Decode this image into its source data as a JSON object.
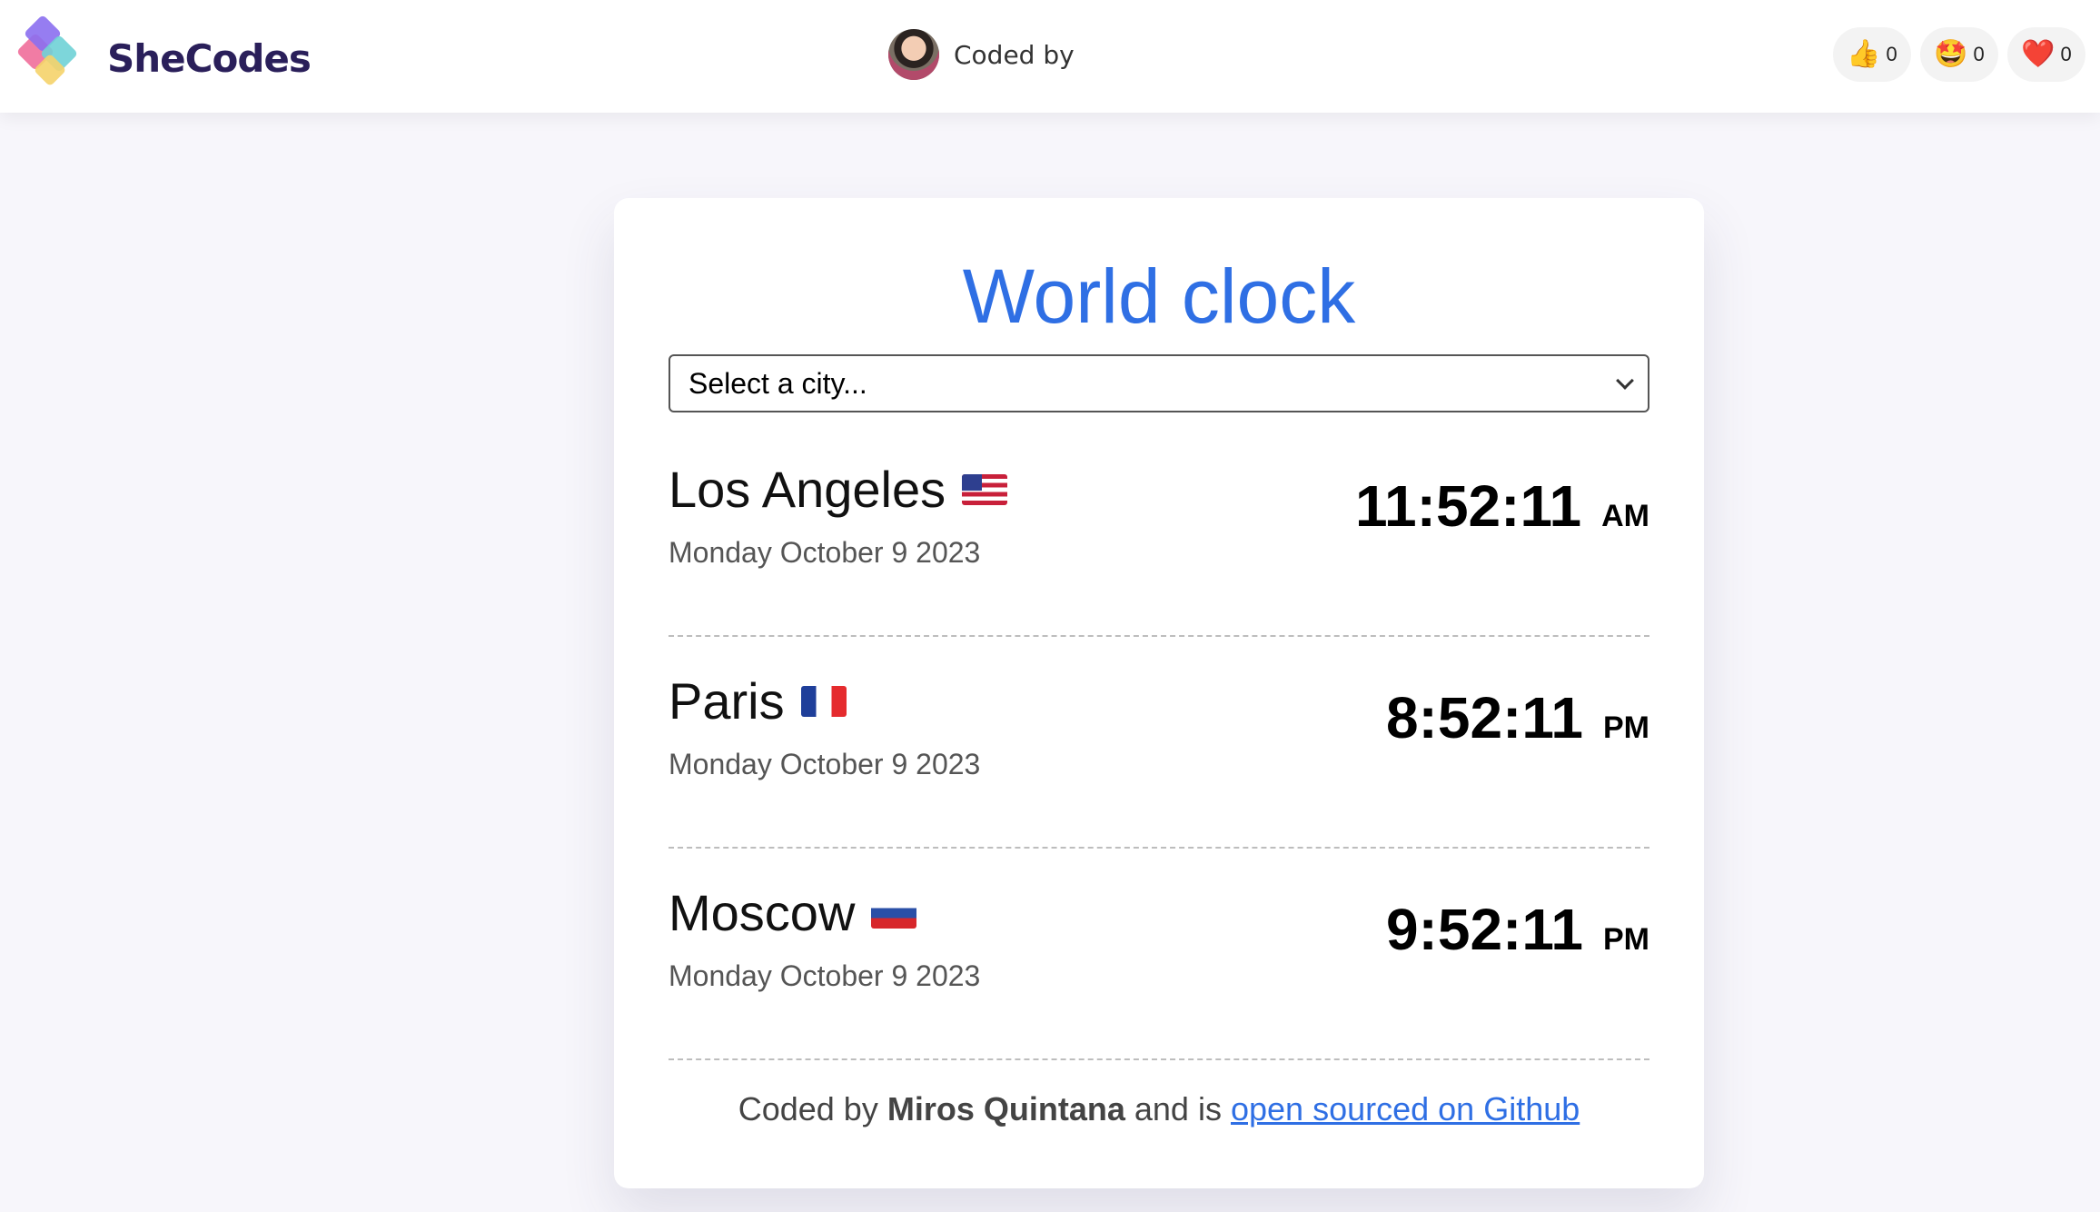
{
  "header": {
    "brand": "SheCodes",
    "author_label": "Coded by",
    "reactions": [
      {
        "icon": "thumbs-up-icon",
        "emoji": "👍",
        "count": "0"
      },
      {
        "icon": "star-struck-icon",
        "emoji": "🤩",
        "count": "0"
      },
      {
        "icon": "heart-icon",
        "emoji": "❤️",
        "count": "0"
      }
    ]
  },
  "app": {
    "title": "World clock",
    "select": {
      "selected": "Select a city..."
    },
    "cities": [
      {
        "name": "Los Angeles",
        "flag": "us-flag",
        "date": "Monday October 9 2023",
        "time": "11:52:11",
        "ampm": "AM"
      },
      {
        "name": "Paris",
        "flag": "fr-flag",
        "date": "Monday October 9 2023",
        "time": "8:52:11",
        "ampm": "PM"
      },
      {
        "name": "Moscow",
        "flag": "ru-flag",
        "date": "Monday October 9 2023",
        "time": "9:52:11",
        "ampm": "PM"
      }
    ],
    "footer": {
      "prefix": "Coded by",
      "author": "Miros Quintana",
      "middle": "and is",
      "link_text": "open sourced on Github"
    }
  },
  "colors": {
    "accent": "#2f6fe4",
    "brand": "#2a1f5a"
  }
}
